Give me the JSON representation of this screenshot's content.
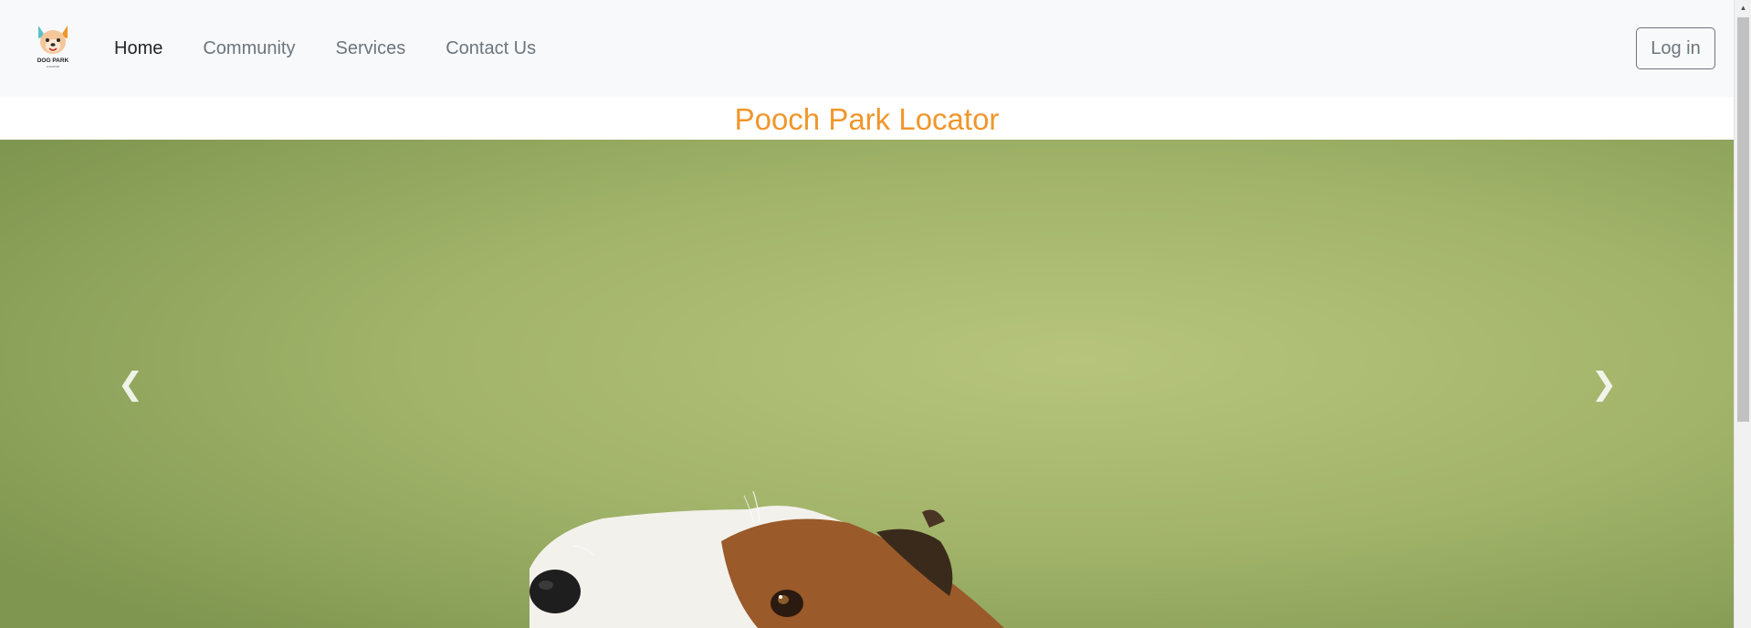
{
  "brand": {
    "logo_text": "DOG PARK",
    "logo_subtext": "LOCATOR"
  },
  "nav": {
    "items": [
      {
        "label": "Home",
        "active": true
      },
      {
        "label": "Community",
        "active": false
      },
      {
        "label": "Services",
        "active": false
      },
      {
        "label": "Contact Us",
        "active": false
      }
    ],
    "login_label": "Log in"
  },
  "page": {
    "title": "Pooch Park Locator"
  },
  "carousel": {
    "prev_icon": "chevron-left-icon",
    "next_icon": "chevron-right-icon",
    "image_subject": "beagle-on-grass"
  },
  "colors": {
    "accent": "#f0962c",
    "navbar_bg": "#f8f9fa",
    "nav_active": "#212529",
    "nav_muted": "#6c757d"
  }
}
